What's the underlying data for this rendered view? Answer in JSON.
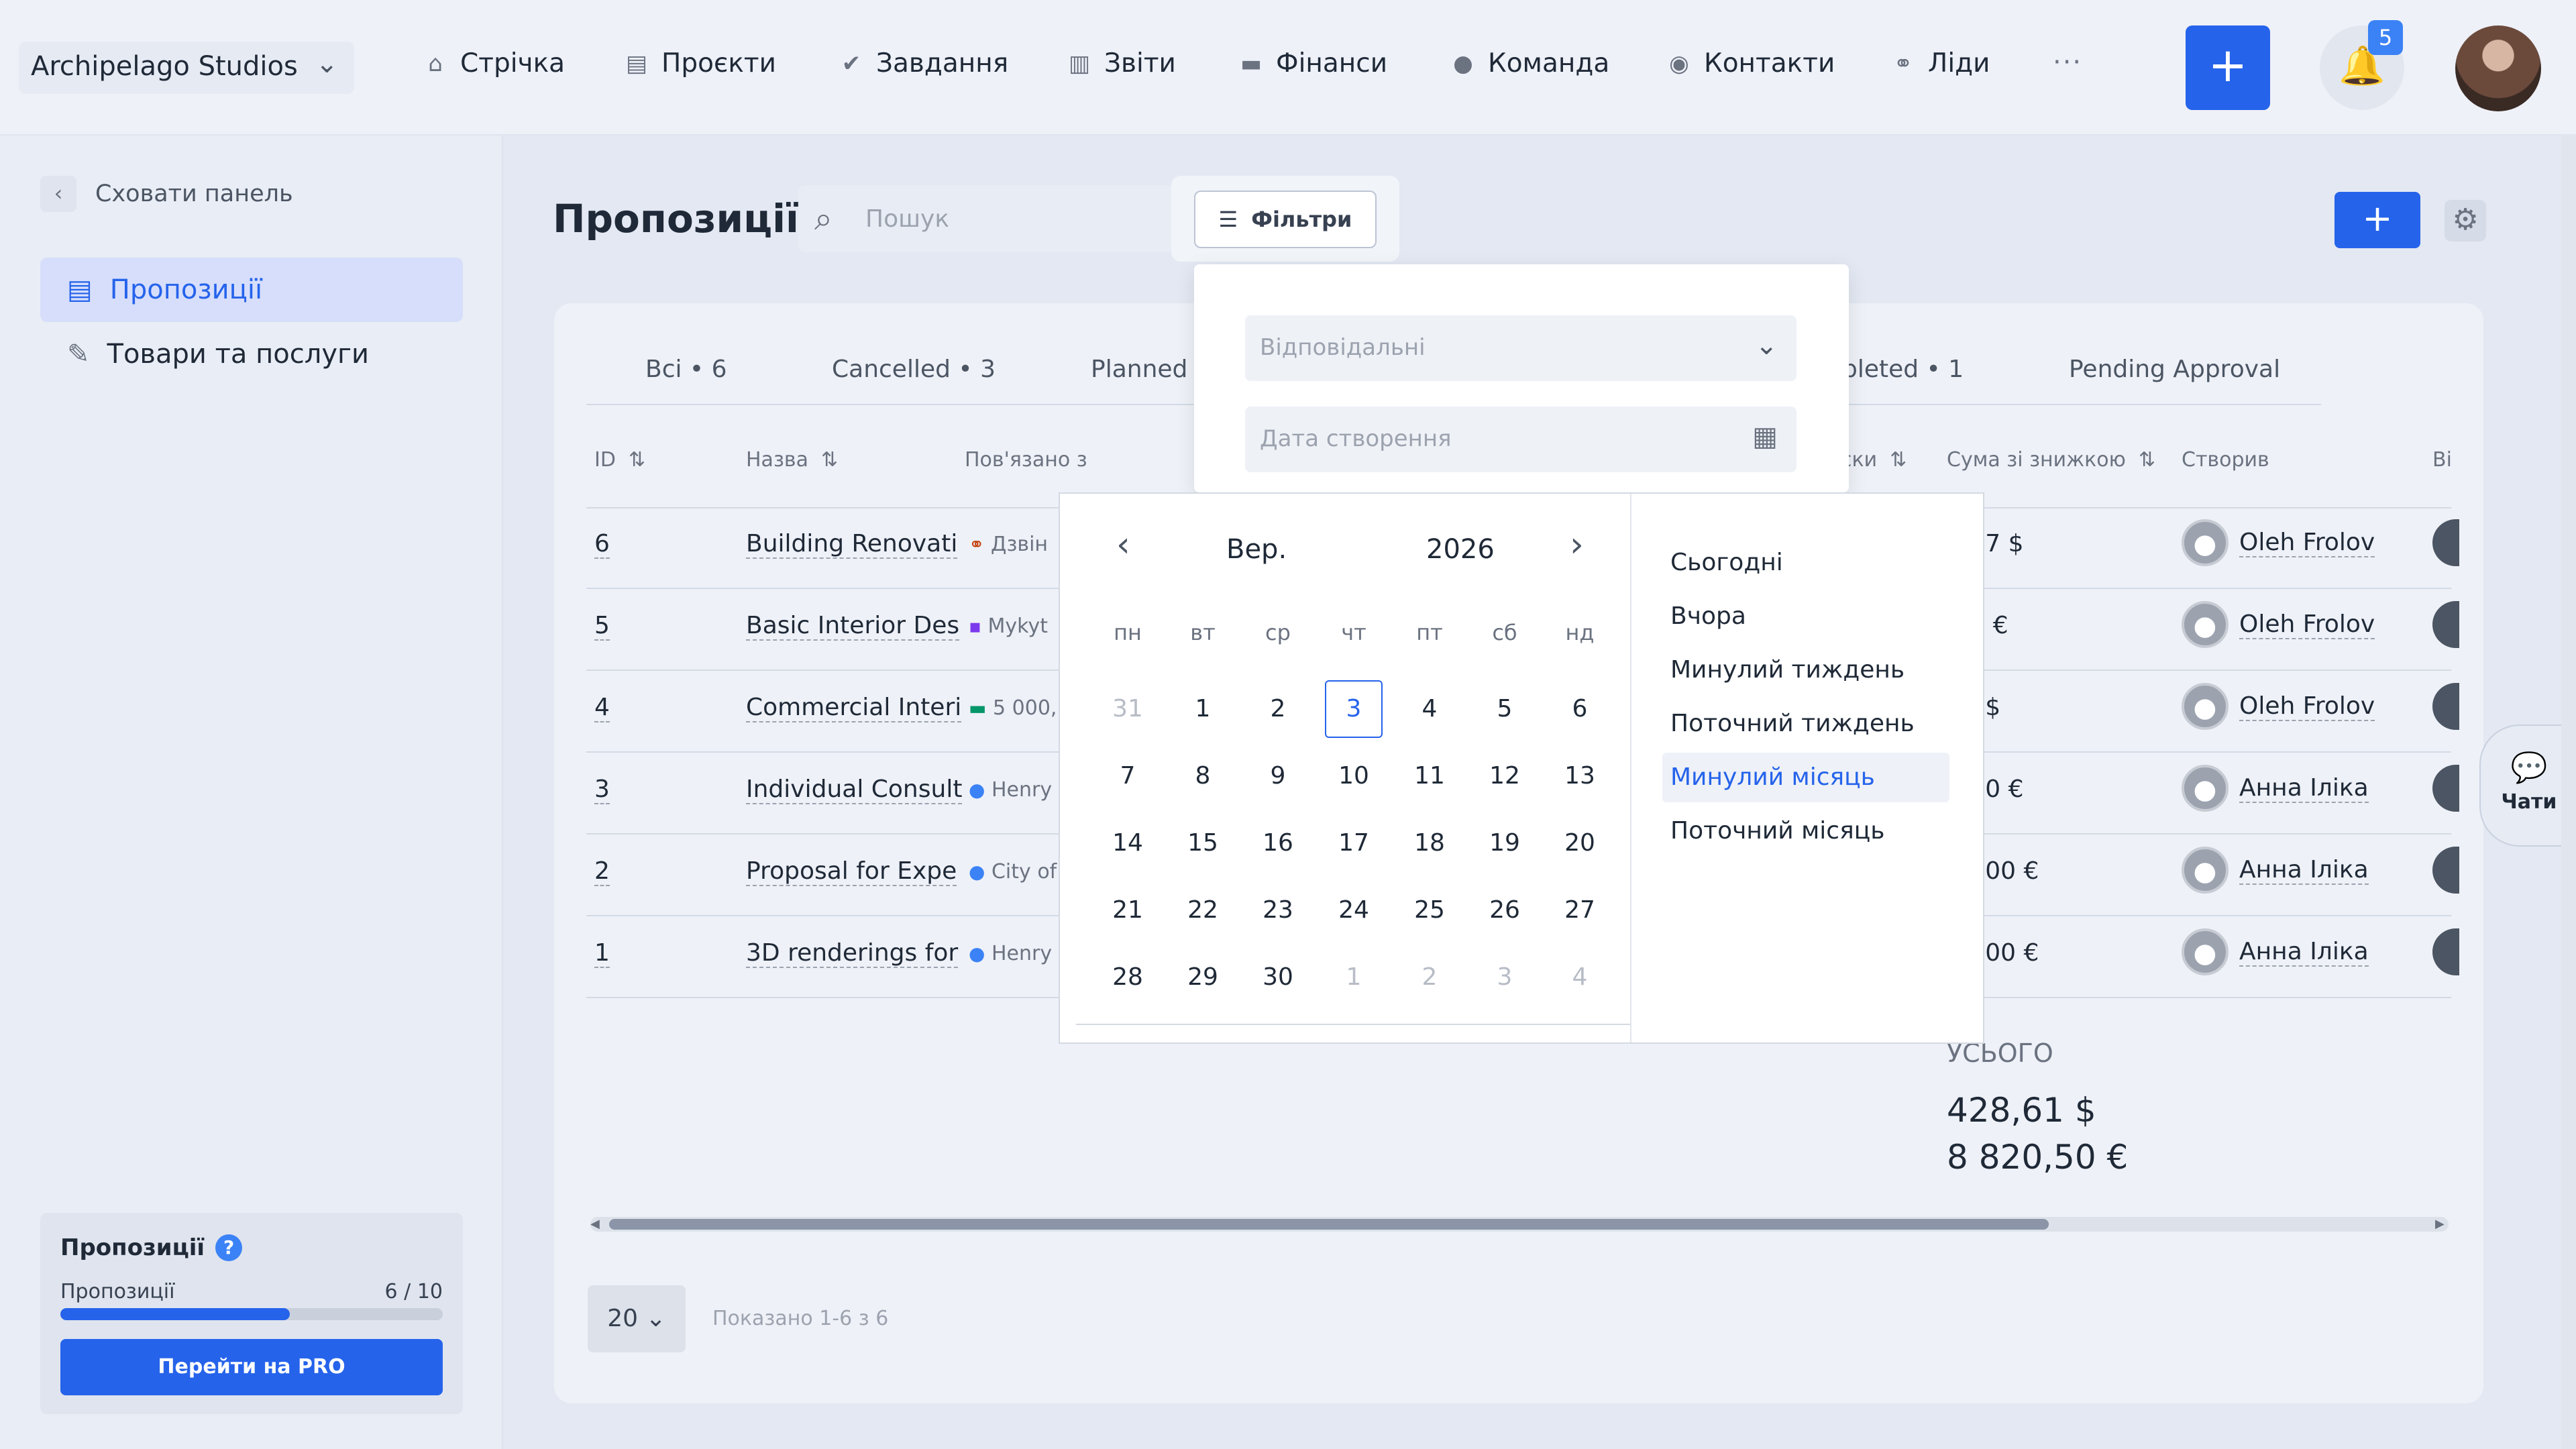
{
  "topbar": {
    "workspace": "Archipelago Studios",
    "nav": [
      {
        "label": "Стрічка",
        "icon": "home-icon"
      },
      {
        "label": "Проєкти",
        "icon": "document-icon"
      },
      {
        "label": "Завдання",
        "icon": "check-circle-icon"
      },
      {
        "label": "Звіти",
        "icon": "report-icon"
      },
      {
        "label": "Фінанси",
        "icon": "wallet-icon"
      },
      {
        "label": "Команда",
        "icon": "person-icon"
      },
      {
        "label": "Контакти",
        "icon": "contacts-icon"
      },
      {
        "label": "Ліди",
        "icon": "leads-icon"
      }
    ],
    "more": "···",
    "notifications": "5"
  },
  "sidebar": {
    "hide_label": "Сховати панель",
    "items": [
      {
        "label": "Пропозиції"
      },
      {
        "label": "Товари та послуги"
      }
    ],
    "pro": {
      "title": "Пропозиції",
      "label": "Пропозиції",
      "count": "6 / 10",
      "progress": 0.6,
      "button": "Перейти на PRO"
    }
  },
  "main": {
    "title": "Пропозиції",
    "search_placeholder": "Пошук",
    "filter_label": "Фільтри",
    "tabs": [
      {
        "label": "Всі • 6"
      },
      {
        "label": "Cancelled • 3"
      },
      {
        "label": "Planned •"
      },
      {
        "label": "pleted • 1"
      },
      {
        "label": "Pending Approval"
      }
    ],
    "columns": {
      "id": "ID",
      "name": "Назва",
      "related": "Пов'язано з",
      "disc": "ски",
      "sum": "Сума зі знижкою",
      "created": "Створив",
      "vendor": "Ві"
    },
    "rows": [
      {
        "id": "6",
        "name": "Building Renovati",
        "related": "Дзвін",
        "sum": "2,97 $",
        "creator": "Oleh Frolov"
      },
      {
        "id": "5",
        "name": "Basic Interior Des",
        "related": "Mykyt",
        "sum": ",00 €",
        "creator": "Oleh Frolov"
      },
      {
        "id": "4",
        "name": "Commercial Interi",
        "related": "5 000,",
        "sum": "64 $",
        "creator": "Oleh Frolov"
      },
      {
        "id": "3",
        "name": "Individual Consult",
        "related": "Henry",
        "sum": "2,50 €",
        "creator": "Анна Іліка"
      },
      {
        "id": "2",
        "name": "Proposal for Expe",
        "related": "City of",
        "sum": "70,00 €",
        "creator": "Анна Іліка"
      },
      {
        "id": "1",
        "name": "3D renderings for",
        "related": "Henry",
        "sum": "50,00 €",
        "creator": "Анна Іліка"
      }
    ],
    "total_label": "УСЬОГО",
    "total_usd": "428,61 $",
    "total_eur": "8 820,50 €",
    "page_size": "20",
    "page_info": "Показано 1-6 з 6",
    "chat_label": "Чати"
  },
  "filter_panel": {
    "responsible_placeholder": "Відповідальні",
    "date_placeholder": "Дата створення"
  },
  "calendar": {
    "month": "Вер.",
    "year": "2026",
    "weekdays": [
      "пн",
      "вт",
      "ср",
      "чт",
      "пт",
      "сб",
      "нд"
    ],
    "weeks": [
      [
        "31",
        "1",
        "2",
        "3",
        "4",
        "5",
        "6"
      ],
      [
        "7",
        "8",
        "9",
        "10",
        "11",
        "12",
        "13"
      ],
      [
        "14",
        "15",
        "16",
        "17",
        "18",
        "19",
        "20"
      ],
      [
        "21",
        "22",
        "23",
        "24",
        "25",
        "26",
        "27"
      ],
      [
        "28",
        "29",
        "30",
        "1",
        "2",
        "3",
        "4"
      ]
    ],
    "today": "3",
    "presets": [
      "Сьогодні",
      "Вчора",
      "Минулий тиждень",
      "Поточний тиждень",
      "Минулий місяць",
      "Поточний місяць"
    ],
    "highlighted_preset": "Минулий місяць"
  },
  "colors": {
    "accent": "#2563eb",
    "background": "#e3e8f2"
  }
}
